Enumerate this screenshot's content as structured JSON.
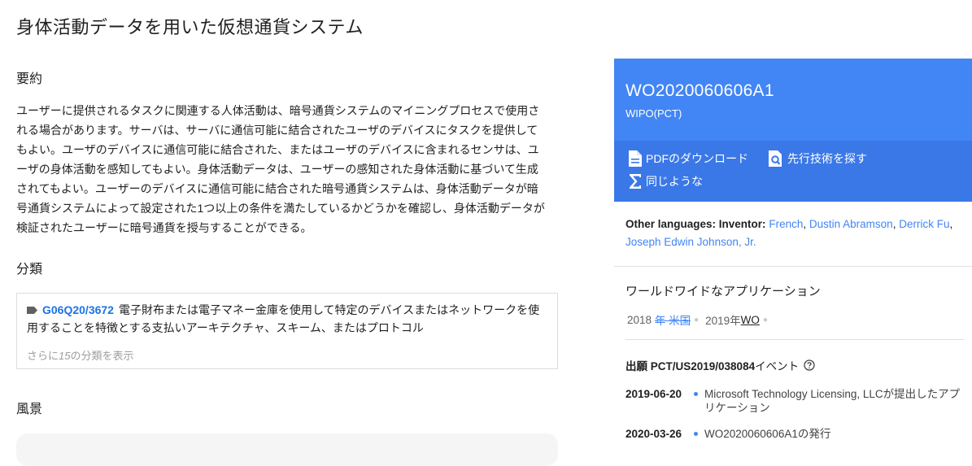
{
  "page": {
    "title": "身体活動データを用いた仮想通貨システム"
  },
  "abstract": {
    "heading": "要約",
    "text": "ユーザーに提供されるタスクに関連する人体活動は、暗号通貨システムのマイニングプロセスで使用される場合があります。サーバは、サーバに通信可能に結合されたユーザのデバイスにタスクを提供してもよい。ユーザのデバイスに通信可能に結合された、またはユーザのデバイスに含まれるセンサは、ユーザの身体活動を感知してもよい。身体活動データは、ユーザーの感知された身体活動に基づいて生成されてもよい。ユーザーのデバイスに通信可能に結合された暗号通貨システムは、身体活動データが暗号通貨システムによって設定された1つ以上の条件を満たしているかどうかを確認し、身体活動データが検証されたユーザーに暗号通貨を授与することができる。"
  },
  "classification": {
    "heading": "分類",
    "code": "G06Q20/3672",
    "description": "電子財布または電子マネー金庫を使用して特定のデバイスまたはネットワークを使用することを特徴とする支払いアーキテクチャ、スキーム、またはプロトコル",
    "more_prefix": "さらに",
    "more_count": "15",
    "more_suffix": "の分類を表示"
  },
  "landscape": {
    "heading": "風景"
  },
  "patent": {
    "number": "WO2020060606A1",
    "office": "WIPO(PCT)",
    "actions": {
      "pdf": "PDFのダウンロード",
      "prior_art": "先行技術を探す",
      "similar": "同じような"
    }
  },
  "languages": {
    "label": "Other languages:",
    "inventor_label": "Inventor:",
    "items": [
      "French",
      "Dustin Abramson",
      "Derrick Fu",
      "Joseph Edwin Johnson, Jr."
    ]
  },
  "worldwide": {
    "title": "ワールドワイドなアプリケーション",
    "year1": "2018",
    "country1": "年 米国",
    "year2": "2019年",
    "country2": "WO"
  },
  "application": {
    "title_bold": "出願 PCT/US2019/038084",
    "title_suffix": "イベント",
    "events": [
      {
        "date": "2019-06-20",
        "text": "Microsoft Technology Licensing, LLCが提出したアプリケーション"
      },
      {
        "date": "2020-03-26",
        "text": "WO2020060606A1の発行"
      }
    ]
  },
  "colors": {
    "panel_blue": "#4285f4",
    "action_blue": "#3b78e7",
    "link_blue": "#4285f4"
  }
}
